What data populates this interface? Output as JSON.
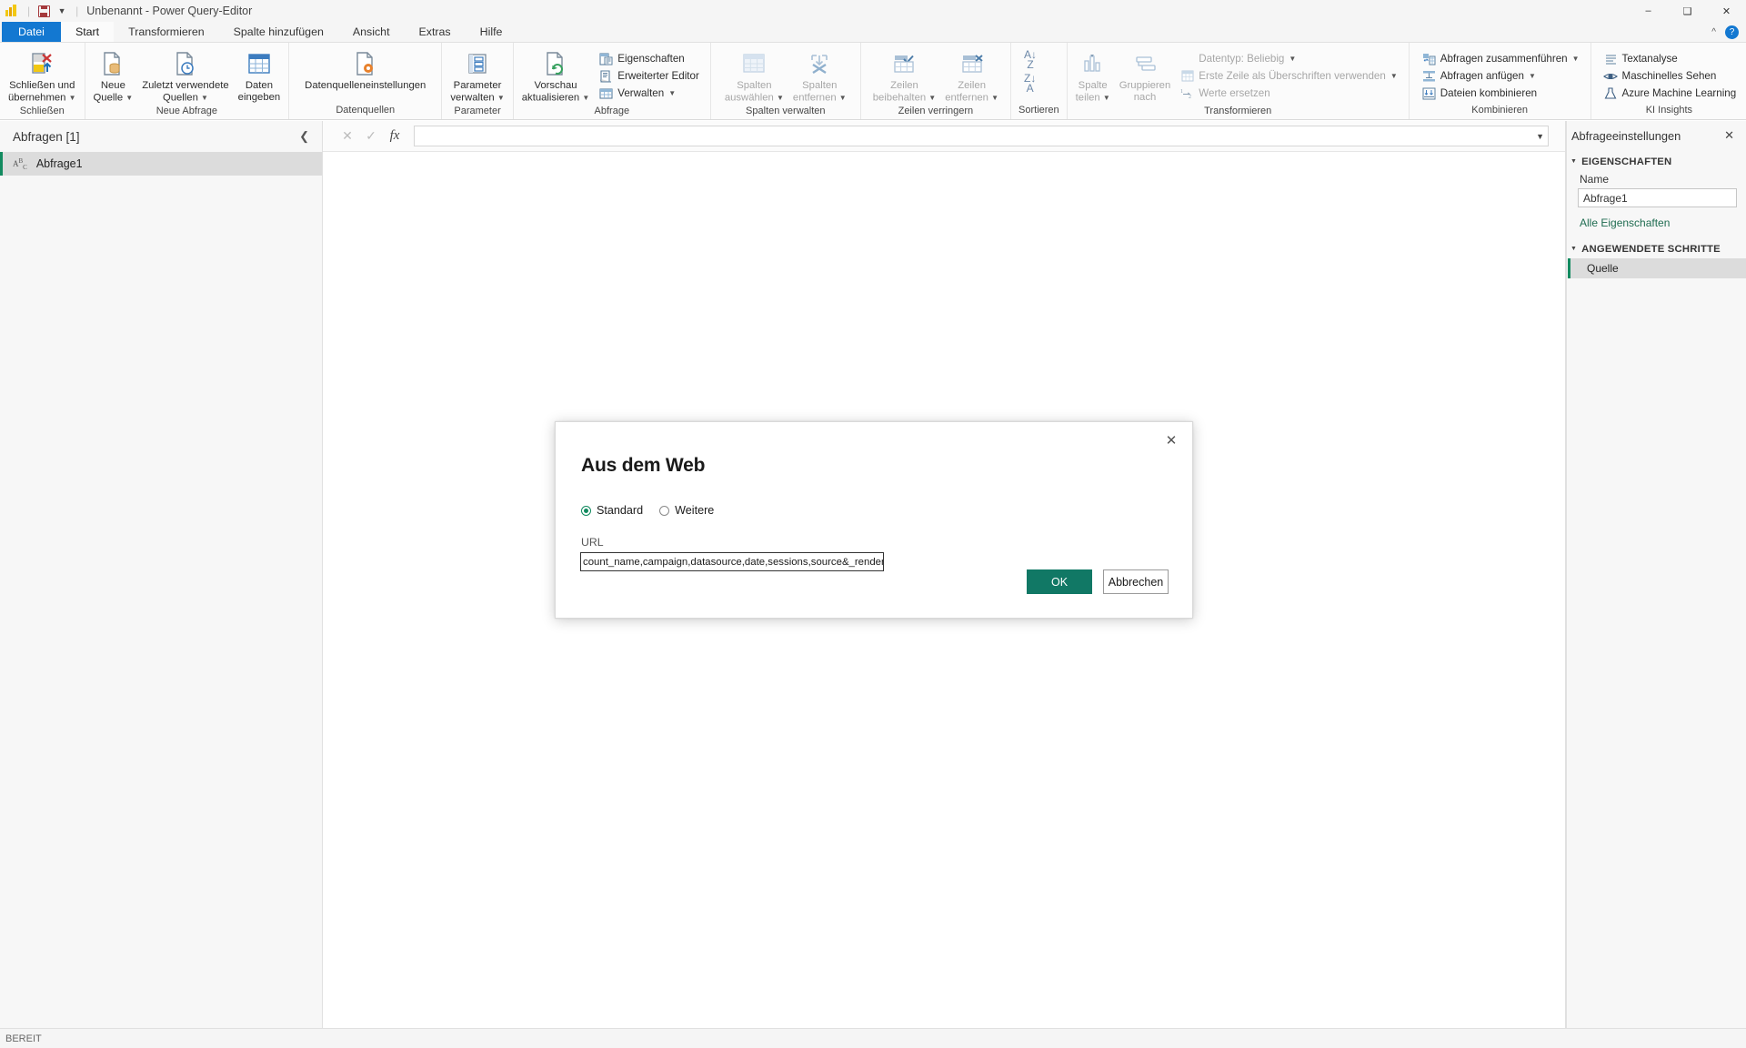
{
  "titlebar": {
    "app_title": "Unbenannt - Power Query-Editor",
    "logo_icon": "powerbi-logo-icon",
    "save_icon": "save-icon",
    "qat_dropdown_icon": "chevron-down-icon",
    "minimize_icon": "minimize-icon",
    "restore_icon": "restore-icon",
    "close_icon": "close-icon",
    "ribbon_collapse_icon": "chevron-up-icon",
    "help_icon": "help-icon"
  },
  "ribbon_tabs": [
    {
      "label": "Datei",
      "state": "file"
    },
    {
      "label": "Start",
      "state": "active"
    },
    {
      "label": "Transformieren",
      "state": "normal"
    },
    {
      "label": "Spalte hinzufügen",
      "state": "normal"
    },
    {
      "label": "Ansicht",
      "state": "normal"
    },
    {
      "label": "Extras",
      "state": "normal"
    },
    {
      "label": "Hilfe",
      "state": "normal"
    }
  ],
  "ribbon_groups": [
    {
      "name": "Schließen",
      "label": "Schließen",
      "buttons": [
        {
          "label_line1": "Schließen und",
          "label_line2": "übernehmen",
          "has_caret": true,
          "icon": "close-and-apply-icon"
        }
      ]
    },
    {
      "name": "Neue Abfrage",
      "label": "Neue Abfrage",
      "buttons": [
        {
          "label_line1": "Neue",
          "label_line2": "Quelle",
          "has_caret": true,
          "icon": "new-source-icon"
        },
        {
          "label_line1": "Zuletzt verwendete",
          "label_line2": "Quellen",
          "has_caret": true,
          "icon": "recent-sources-icon"
        },
        {
          "label_line1": "Daten",
          "label_line2": "eingeben",
          "has_caret": false,
          "icon": "enter-data-icon"
        }
      ]
    },
    {
      "name": "Datenquellen",
      "label": "Datenquellen",
      "buttons": [
        {
          "label_line1": "Datenquelleneinstellungen",
          "label_line2": "",
          "has_caret": false,
          "icon": "data-source-settings-icon"
        }
      ]
    },
    {
      "name": "Parameter",
      "label": "Parameter",
      "buttons": [
        {
          "label_line1": "Parameter",
          "label_line2": "verwalten",
          "has_caret": true,
          "icon": "manage-parameters-icon"
        }
      ]
    },
    {
      "name": "Abfrage",
      "label": "Abfrage",
      "buttons": [
        {
          "label_line1": "Vorschau",
          "label_line2": "aktualisieren",
          "has_caret": true,
          "icon": "refresh-preview-icon"
        }
      ],
      "small_buttons": [
        {
          "label": "Eigenschaften",
          "icon": "properties-icon",
          "has_caret": false
        },
        {
          "label": "Erweiterter Editor",
          "icon": "advanced-editor-icon",
          "has_caret": false
        },
        {
          "label": "Verwalten",
          "icon": "manage-icon",
          "has_caret": true
        }
      ]
    },
    {
      "name": "Spalten verwalten",
      "label": "Spalten verwalten",
      "buttons": [
        {
          "label_line1": "Spalten",
          "label_line2": "auswählen",
          "has_caret": true,
          "icon": "choose-columns-icon",
          "disabled": true
        },
        {
          "label_line1": "Spalten",
          "label_line2": "entfernen",
          "has_caret": true,
          "icon": "remove-columns-icon",
          "disabled": true
        }
      ]
    },
    {
      "name": "Zeilen verringern",
      "label": "Zeilen verringern",
      "buttons": [
        {
          "label_line1": "Zeilen",
          "label_line2": "beibehalten",
          "has_caret": true,
          "icon": "keep-rows-icon",
          "disabled": true
        },
        {
          "label_line1": "Zeilen",
          "label_line2": "entfernen",
          "has_caret": true,
          "icon": "remove-rows-icon",
          "disabled": true
        }
      ]
    },
    {
      "name": "Sortieren",
      "label": "Sortieren",
      "buttons": [
        {
          "label_line1": "",
          "label_line2": "",
          "has_caret": false,
          "icon": "sort-ascending-descending-icon",
          "disabled": true
        }
      ]
    },
    {
      "name": "Transformieren",
      "label": "Transformieren",
      "buttons": [
        {
          "label_line1": "Spalte",
          "label_line2": "teilen",
          "has_caret": true,
          "icon": "split-column-icon",
          "disabled": true
        },
        {
          "label_line1": "Gruppieren",
          "label_line2": "nach",
          "has_caret": false,
          "icon": "group-by-icon",
          "disabled": true
        }
      ],
      "small_buttons": [
        {
          "label": "Datentyp: Beliebig",
          "icon": "data-type-icon",
          "has_caret": true,
          "disabled": true
        },
        {
          "label": "Erste Zeile als Überschriften verwenden",
          "icon": "use-first-row-as-headers-icon",
          "has_caret": true,
          "disabled": true
        },
        {
          "label": "Werte ersetzen",
          "icon": "replace-values-icon",
          "has_caret": false,
          "disabled": true
        }
      ]
    },
    {
      "name": "Kombinieren",
      "label": "Kombinieren",
      "small_buttons": [
        {
          "label": "Abfragen zusammenführen",
          "icon": "merge-queries-icon",
          "has_caret": true
        },
        {
          "label": "Abfragen anfügen",
          "icon": "append-queries-icon",
          "has_caret": true
        },
        {
          "label": "Dateien kombinieren",
          "icon": "combine-files-icon",
          "has_caret": false
        }
      ]
    },
    {
      "name": "KI Insights",
      "label": "KI Insights",
      "small_buttons": [
        {
          "label": "Textanalyse",
          "icon": "text-analytics-icon",
          "has_caret": false
        },
        {
          "label": "Maschinelles Sehen",
          "icon": "vision-icon",
          "has_caret": false
        },
        {
          "label": "Azure Machine Learning",
          "icon": "azure-ml-icon",
          "has_caret": false
        }
      ]
    }
  ],
  "queries_pane": {
    "title": "Abfragen [1]",
    "collapse_icon": "chevron-left-icon",
    "items": [
      {
        "label": "Abfrage1",
        "type_icon": "abc-text-type-icon",
        "selected": true
      }
    ]
  },
  "formula_bar": {
    "cancel_icon": "close-icon",
    "accept_icon": "checkmark-icon",
    "fx_icon": "fx-icon",
    "value": "",
    "expand_icon": "chevron-down-icon"
  },
  "settings_pane": {
    "title": "Abfrageeinstellungen",
    "close_icon": "close-icon",
    "properties_section": {
      "title": "EIGENSCHAFTEN",
      "expand_icon": "triangle-down-icon",
      "name_label": "Name",
      "name_value": "Abfrage1",
      "all_properties_link": "Alle Eigenschaften"
    },
    "applied_steps_section": {
      "title": "ANGEWENDETE SCHRITTE",
      "expand_icon": "triangle-down-icon",
      "steps": [
        {
          "label": "Quelle",
          "selected": true
        }
      ]
    }
  },
  "statusbar": {
    "status": "BEREIT"
  },
  "dialog": {
    "title": "Aus dem Web",
    "close_icon": "close-icon",
    "radio_options": [
      {
        "label": "Standard",
        "selected": true
      },
      {
        "label": "Weitere",
        "selected": false
      }
    ],
    "url_label": "URL",
    "url_value": "count_name,campaign,datasource,date,sessions,source&_renderer=powerbi",
    "ok_label": "OK",
    "cancel_label": "Abbrechen"
  },
  "colors": {
    "accent_green": "#117865",
    "file_tab_blue": "#1177d1",
    "step_marker": "#118a5f"
  }
}
